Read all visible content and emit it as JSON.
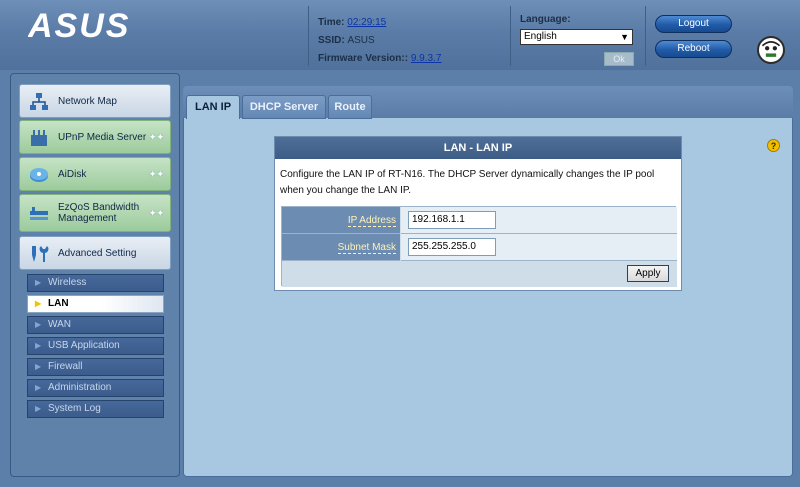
{
  "header": {
    "brand": "ASUS",
    "time_label": "Time:",
    "time_value": "02:29:15",
    "ssid_label": "SSID:",
    "ssid_value": "ASUS",
    "firmware_label": "Firmware Version::",
    "firmware_value": "9.9.3.7",
    "language_label": "Language:",
    "language_selected": "English",
    "ok_label": "Ok",
    "logout_label": "Logout",
    "reboot_label": "Reboot"
  },
  "sidebar": {
    "main": [
      {
        "label": "Network Map",
        "icon": "network-map-icon"
      },
      {
        "label": "UPnP Media Server",
        "icon": "media-server-icon"
      },
      {
        "label": "AiDisk",
        "icon": "aidisk-icon"
      },
      {
        "label": "EzQoS Bandwidth Management",
        "icon": "ezqos-icon"
      },
      {
        "label": "Advanced Setting",
        "icon": "tools-icon"
      }
    ],
    "sub": [
      "Wireless",
      "LAN",
      "WAN",
      "USB Application",
      "Firewall",
      "Administration",
      "System Log"
    ],
    "active_sub": "LAN"
  },
  "tabs": [
    "LAN IP",
    "DHCP Server",
    "Route"
  ],
  "active_tab": "LAN IP",
  "panel": {
    "title": "LAN - LAN IP",
    "description": "Configure the LAN IP of RT-N16. The DHCP Server dynamically changes the IP pool when you change the LAN IP.",
    "ip_label": "IP Address",
    "ip_value": "192.168.1.1",
    "mask_label": "Subnet Mask",
    "mask_value": "255.255.255.0",
    "apply_label": "Apply"
  },
  "colors": {
    "header_bg": "#5a7ca6",
    "content_bg": "#a8c7e0",
    "panel_title_bg": "#3d5c86",
    "label_text": "#fff2b8"
  }
}
